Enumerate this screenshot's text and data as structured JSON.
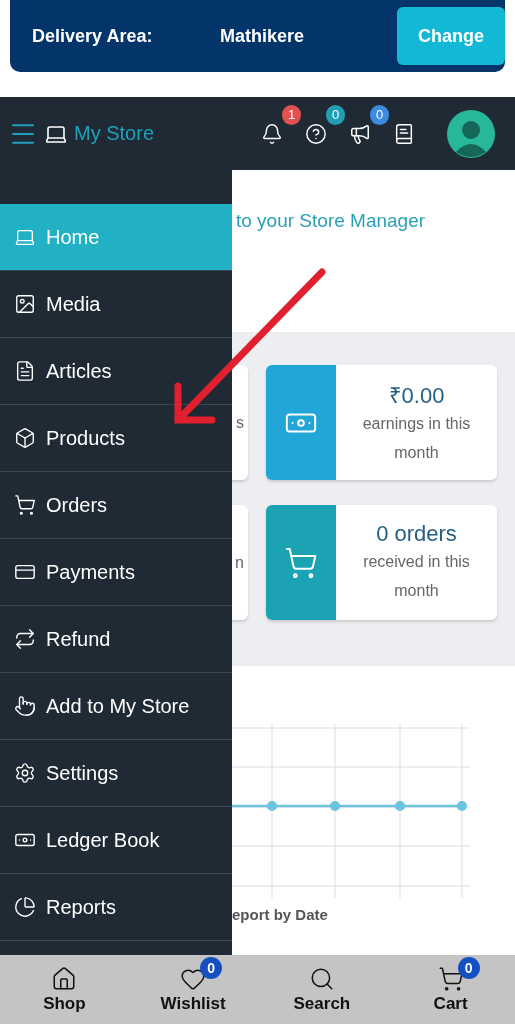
{
  "delivery": {
    "label": "Delivery Area:",
    "area": "Mathikere",
    "button": "Change"
  },
  "header": {
    "title": "My Store",
    "actions": [
      {
        "kind": "bell",
        "badge": "1",
        "color": "#e0514f"
      },
      {
        "kind": "help",
        "badge": "0",
        "color": "#1f9fb2"
      },
      {
        "kind": "megaphone",
        "badge": "0",
        "color": "#3d8be0"
      },
      {
        "kind": "book"
      }
    ]
  },
  "sidebar": {
    "items": [
      {
        "kind": "laptop",
        "label": "Home",
        "selected": true
      },
      {
        "kind": "image",
        "label": "Media",
        "selected": false
      },
      {
        "kind": "file",
        "label": "Articles",
        "selected": false
      },
      {
        "kind": "box",
        "label": "Products",
        "selected": false
      },
      {
        "kind": "cart",
        "label": "Orders",
        "selected": false
      },
      {
        "kind": "card",
        "label": "Payments",
        "selected": false
      },
      {
        "kind": "repeat",
        "label": "Refund",
        "selected": false
      },
      {
        "kind": "hand",
        "label": "Add to My Store",
        "selected": false
      },
      {
        "kind": "cogs",
        "label": "Settings",
        "selected": false
      },
      {
        "kind": "money",
        "label": "Ledger Book",
        "selected": false
      },
      {
        "kind": "pie",
        "label": "Reports",
        "selected": false
      }
    ]
  },
  "welcome": "to your Store Manager",
  "stat_cards": [
    {
      "kind": "covered",
      "text": "s"
    },
    {
      "kind": "earnings",
      "value": "₹0.00",
      "caption": "earnings in this month",
      "color": "#22a6d8"
    },
    {
      "kind": "covered",
      "text": "n"
    },
    {
      "kind": "orders",
      "value": "0 orders",
      "caption": "received in this month",
      "color": "#1ba3b4"
    }
  ],
  "chart": {
    "title": "eport by Date"
  },
  "bottom_nav": [
    {
      "kind": "home",
      "label": "Shop"
    },
    {
      "kind": "heart",
      "label": "Wishlist",
      "badge": "0"
    },
    {
      "kind": "search",
      "label": "Search"
    },
    {
      "kind": "cart",
      "label": "Cart",
      "badge": "0"
    }
  ]
}
